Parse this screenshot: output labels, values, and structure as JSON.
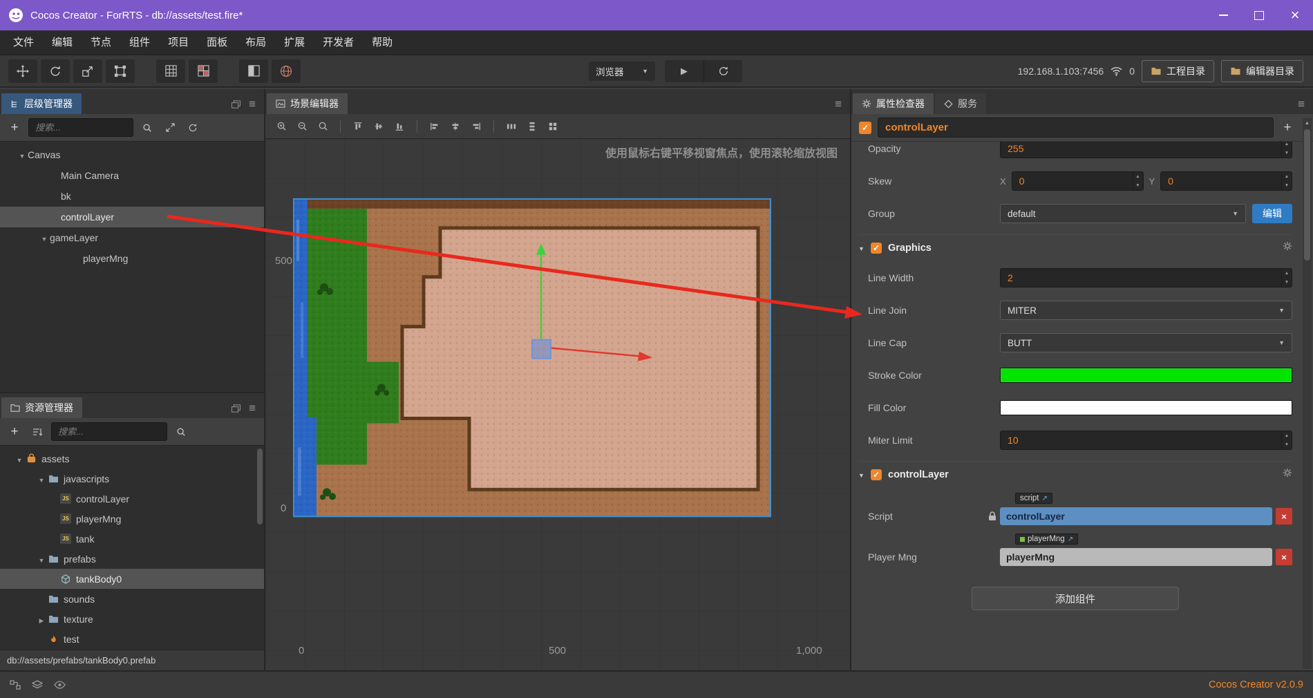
{
  "colors": {
    "titlebar_purple": "#7D58C8",
    "accent_orange": "#F0862C",
    "stroke_color": "#00E400",
    "fill_color": "#FFFFFF",
    "script_ref_blue": "#5D8FC2",
    "edit_button_blue": "#2F7CC4"
  },
  "titlebar": {
    "title": "Cocos Creator - ForRTS - db://assets/test.fire*"
  },
  "menu": {
    "items": [
      "文件",
      "编辑",
      "节点",
      "组件",
      "项目",
      "面板",
      "布局",
      "扩展",
      "开发者",
      "帮助"
    ]
  },
  "toolbar": {
    "preview_label": "浏览器",
    "address": "192.168.1.103:7456",
    "device_count": "0",
    "project_dir": "工程目录",
    "editor_dir": "编辑器目录"
  },
  "hierarchy": {
    "tab": "层级管理器",
    "search_placeholder": "搜索...",
    "nodes": [
      {
        "label": "Canvas"
      },
      {
        "label": "Main Camera"
      },
      {
        "label": "bk"
      },
      {
        "label": "controlLayer"
      },
      {
        "label": "gameLayer"
      },
      {
        "label": "playerMng"
      }
    ]
  },
  "assets": {
    "tab": "资源管理器",
    "search_placeholder": "搜索...",
    "js_icon_label": "JS",
    "status": "db://assets/prefabs/tankBody0.prefab",
    "nodes": [
      {
        "label": "assets"
      },
      {
        "label": "javascripts"
      },
      {
        "label": "controlLayer"
      },
      {
        "label": "playerMng"
      },
      {
        "label": "tank"
      },
      {
        "label": "prefabs"
      },
      {
        "label": "tankBody0"
      },
      {
        "label": "sounds"
      },
      {
        "label": "texture"
      },
      {
        "label": "test"
      }
    ]
  },
  "scene": {
    "tab": "场景编辑器",
    "hint": "使用鼠标右键平移视窗焦点，使用滚轮缩放视图",
    "ruler_left_top": "500",
    "ruler_left_bottom": "0",
    "ruler_bottom_0": "0",
    "ruler_bottom_500": "500",
    "ruler_bottom_1000": "1,000"
  },
  "inspector": {
    "tab_properties": "属性检查器",
    "tab_services": "服务",
    "node_name": "controlLayer",
    "opacity_label": "Opacity",
    "opacity_value": "255",
    "skew_label": "Skew",
    "axis_x": "X",
    "axis_y": "Y",
    "skew_x": "0",
    "skew_y": "0",
    "group_label": "Group",
    "group_value": "default",
    "group_edit": "编辑",
    "graphics": {
      "title": "Graphics",
      "line_width_label": "Line Width",
      "line_width": "2",
      "line_join_label": "Line Join",
      "line_join": "MITER",
      "line_cap_label": "Line Cap",
      "line_cap": "BUTT",
      "stroke_label": "Stroke Color",
      "fill_label": "Fill Color",
      "miter_label": "Miter Limit",
      "miter_limit": "10"
    },
    "control_layer": {
      "title": "controlLayer",
      "script_label": "Script",
      "script_badge": "script",
      "script_value": "controlLayer",
      "player_label": "Player Mng",
      "player_badge": "playerMng",
      "player_value": "playerMng"
    },
    "add_component": "添加组件"
  },
  "statusbar": {
    "version": "Cocos Creator v2.0.9"
  }
}
